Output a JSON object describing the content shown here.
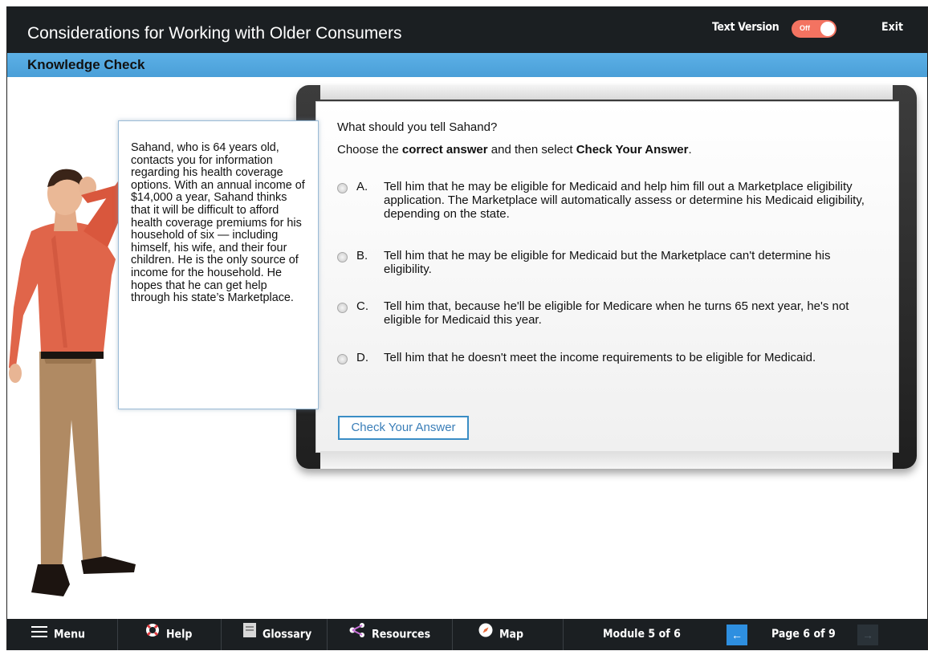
{
  "header": {
    "title": "Considerations for Working with Older Consumers",
    "text_version_label": "Text Version",
    "toggle_state": "Off",
    "exit_label": "Exit"
  },
  "section": {
    "title": "Knowledge Check"
  },
  "scenario": {
    "text": "Sahand, who is 64 years old, contacts you for information regarding his health coverage options. With an annual income of $14,000 a year, Sahand thinks that it will be difficult to afford health coverage premiums for his household of six — including himself, his wife, and their four children. He is the only source of income for the household. He hopes that he can get help through his state’s Marketplace."
  },
  "quiz": {
    "question": "What should you tell Sahand?",
    "instruction_pre": "Choose the ",
    "instruction_bold1": "correct answer",
    "instruction_mid": " and then select ",
    "instruction_bold2": "Check Your Answer",
    "instruction_post": ".",
    "options": [
      {
        "letter": "A.",
        "text": "Tell him that he may be eligible for Medicaid and help him fill out a Marketplace eligibility application. The Marketplace will automatically assess or determine his Medicaid eligibility, depending on the state."
      },
      {
        "letter": "B.",
        "text": "Tell him that he may be eligible for Medicaid but the Marketplace can't determine his eligibility."
      },
      {
        "letter": "C.",
        "text": "Tell him that, because he'll be eligible for Medicare when he turns 65 next year, he's not eligible for Medicaid this year."
      },
      {
        "letter": "D.",
        "text": "Tell him that he doesn't meet the income requirements to be eligible for Medicaid."
      }
    ],
    "check_button": "Check Your Answer"
  },
  "footer": {
    "menu": "Menu",
    "help": "Help",
    "glossary": "Glossary",
    "resources": "Resources",
    "map": "Map",
    "module": "Module 5 of 6",
    "page": "Page 6 of 9",
    "prev_icon": "←",
    "next_icon": "→"
  },
  "colors": {
    "accent_blue": "#4a9fd8",
    "toggle_off": "#f37361",
    "dark_bar": "#1b1f22",
    "nav_prev": "#2e8fe0"
  }
}
